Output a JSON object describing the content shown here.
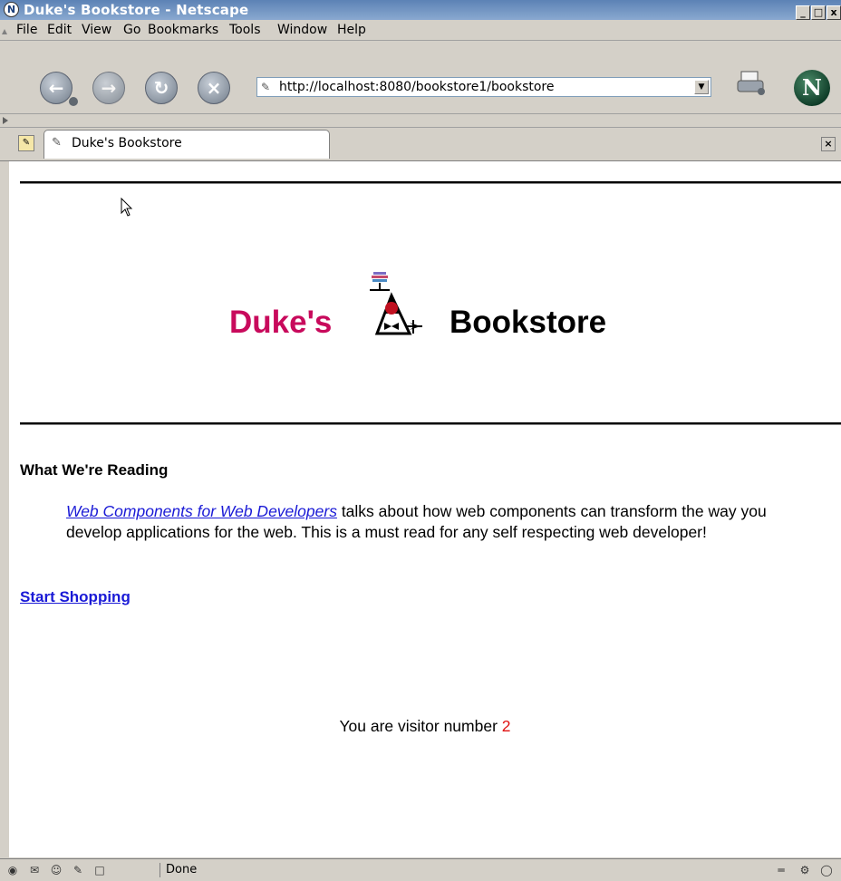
{
  "window": {
    "title": "Duke's Bookstore - Netscape",
    "minimize_glyph": "_",
    "maximize_glyph": "□",
    "close_glyph": "x"
  },
  "menu": {
    "items": [
      "File",
      "Edit",
      "View",
      "Go",
      "Bookmarks",
      "Tools",
      "Window",
      "Help"
    ]
  },
  "toolbar": {
    "url": "http://localhost:8080/bookstore1/bookstore",
    "back_icon": "back-arrow-icon",
    "forward_icon": "forward-arrow-icon",
    "reload_icon": "reload-icon",
    "stop_icon": "stop-icon",
    "logo_letter": "N"
  },
  "tabs": [
    {
      "label": "Duke's Bookstore"
    }
  ],
  "page": {
    "brand_left": "Duke's",
    "brand_right": "Bookstore",
    "heading": "What We're Reading",
    "book_link": "Web Components for Web Developers",
    "book_desc": " talks about how web components can transform the way you develop applications for the web. This is a must read for any self respecting web developer!",
    "shop_link": "Start Shopping",
    "visitor_text": "You are visitor number ",
    "visitor_count": "2"
  },
  "status": {
    "text": "Done"
  },
  "colors": {
    "brand_magenta": "#c80a5c",
    "link_blue": "#1a1ad6",
    "counter_red": "#e01010",
    "titlebar_blue": "#5c82b5"
  }
}
